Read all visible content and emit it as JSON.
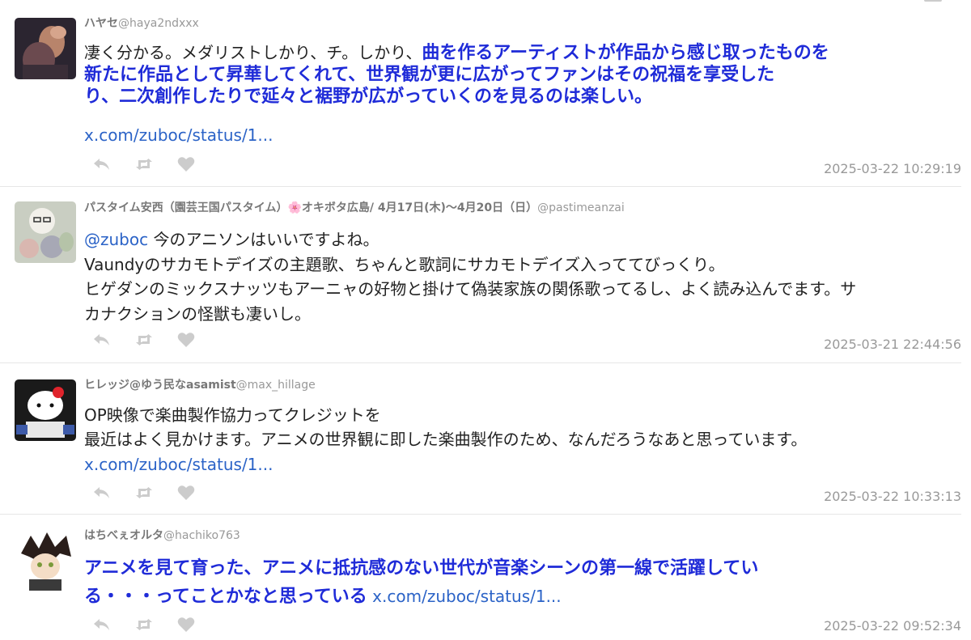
{
  "tweets": [
    {
      "display_name": "ハヤセ",
      "screen_name": "@haya2ndxxx",
      "text_lines": [
        {
          "plain": "凄く分かる。メダリストしかり、チ。しかり、",
          "highlight": "曲を作るアーティストが作品から感じ取ったものを"
        },
        {
          "plain": "",
          "highlight": "新たに作品として昇華してくれて、世界観が更に広がってファンはその祝福を享受した"
        },
        {
          "plain": "",
          "highlight": "り、二次創作したりで延々と裾野が広がっていくのを見るのは楽しい。"
        }
      ],
      "link": "x.com/zuboc/status/1...",
      "timestamp": "2025-03-22 10:29:19"
    },
    {
      "display_name": "パスタイム安西（園芸王国パスタイム）🌸オキボタ広島/ 4月17日(木)〜4月20日（日）",
      "screen_name": "@pastimeanzai",
      "mention": "@zuboc",
      "text_lines": [
        " 今のアニソンはいいですよね。",
        "Vaundyのサカモトデイズの主題歌、ちゃんと歌詞にサカモトデイズ入っててびっくり。",
        "ヒゲダンのミックスナッツもアーニャの好物と掛けて偽装家族の関係歌ってるし、よく読み込んでます。サ",
        "カナクションの怪獣も凄いし。"
      ],
      "timestamp": "2025-03-21 22:44:56"
    },
    {
      "display_name": "ヒレッジ@ゆう民なasamist",
      "screen_name": "@max_hillage",
      "text_lines": [
        "OP映像で楽曲製作協力ってクレジットを",
        "最近はよく見かけます。アニメの世界観に即した楽曲製作のため、なんだろうなあと思っています。"
      ],
      "link": "x.com/zuboc/status/1...",
      "timestamp": "2025-03-22 10:33:13"
    },
    {
      "display_name": "はちべぇオルタ",
      "screen_name": "@hachiko763",
      "text_lines": [
        "アニメを見て育った、アニメに抵抗感のない世代が音楽シーンの第一線で活躍してい",
        "る・・・ってことかなと思っている"
      ],
      "link": "x.com/zuboc/status/1...",
      "timestamp": "2025-03-22 09:52:34"
    }
  ],
  "icons": {
    "reply": "reply-icon",
    "retweet": "retweet-icon",
    "like": "heart-icon"
  },
  "colors": {
    "highlight": "#1f2bd8",
    "link": "#2b63c7",
    "muted": "#999999",
    "action_icon": "#cccccc"
  }
}
